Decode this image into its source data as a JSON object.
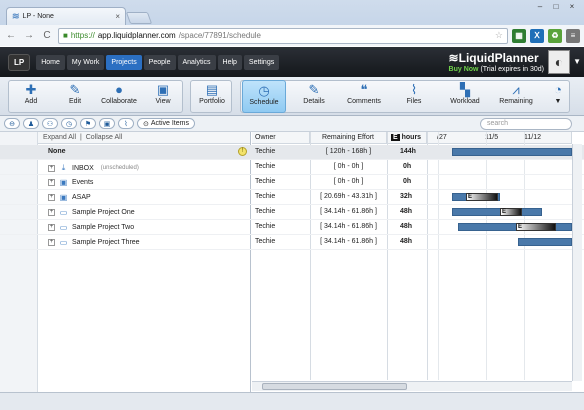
{
  "browser": {
    "tab_title": "LP - None",
    "url_https": "https://",
    "url_host": "app.liquidplanner.com",
    "url_path": "/space/77891/schedule"
  },
  "app": {
    "logo": "LP",
    "nav": [
      "Home",
      "My Work",
      "Projects",
      "People",
      "Analytics",
      "Help",
      "Settings"
    ],
    "brand": "LiquidPlanner",
    "buy_now": "Buy Now",
    "trial": "(Trial expires in 30d)"
  },
  "ribbon": {
    "add": "Add",
    "edit": "Edit",
    "collaborate": "Collaborate",
    "view": "View",
    "portfolio": "Portfolio",
    "schedule": "Schedule",
    "details": "Details",
    "comments": "Comments",
    "files": "Files",
    "workload": "Workload",
    "remaining": "Remaining"
  },
  "subbar": {
    "active_items": "Active Items",
    "search_placeholder": "search"
  },
  "tree": {
    "expand_all": "Expand All",
    "collapse_all": "Collapse All"
  },
  "columns": {
    "owner": "Owner",
    "remaining": "Remaining Effort",
    "hours": "hours",
    "hours_badge": "E",
    "dates": [
      "/27",
      "11/5",
      "11/12"
    ]
  },
  "rows": [
    {
      "name": "None",
      "owner": "Techie",
      "remaining": "[ 120h - 168h ]",
      "hours": "144h",
      "sub": ""
    },
    {
      "name": "INBOX",
      "owner": "Techie",
      "remaining": "[ 0h - 0h ]",
      "hours": "0h",
      "sub": "(unscheduled)"
    },
    {
      "name": "Events",
      "owner": "Techie",
      "remaining": "[ 0h - 0h ]",
      "hours": "0h",
      "sub": ""
    },
    {
      "name": "ASAP",
      "owner": "Techie",
      "remaining": "[ 20.69h - 43.31h ]",
      "hours": "32h",
      "sub": ""
    },
    {
      "name": "Sample Project One",
      "owner": "Techie",
      "remaining": "[ 34.14h - 61.86h ]",
      "hours": "48h",
      "sub": ""
    },
    {
      "name": "Sample Project Two",
      "owner": "Techie",
      "remaining": "[ 34.14h - 61.86h ]",
      "hours": "48h",
      "sub": ""
    },
    {
      "name": "Sample Project Three",
      "owner": "Techie",
      "remaining": "[ 34.14h - 61.86h ]",
      "hours": "48h",
      "sub": ""
    }
  ],
  "gantt_label": "E",
  "colors": {
    "nav_active": "#2b6fc2",
    "gantt": "#4a79aa",
    "buy_now": "#6fd24a"
  }
}
